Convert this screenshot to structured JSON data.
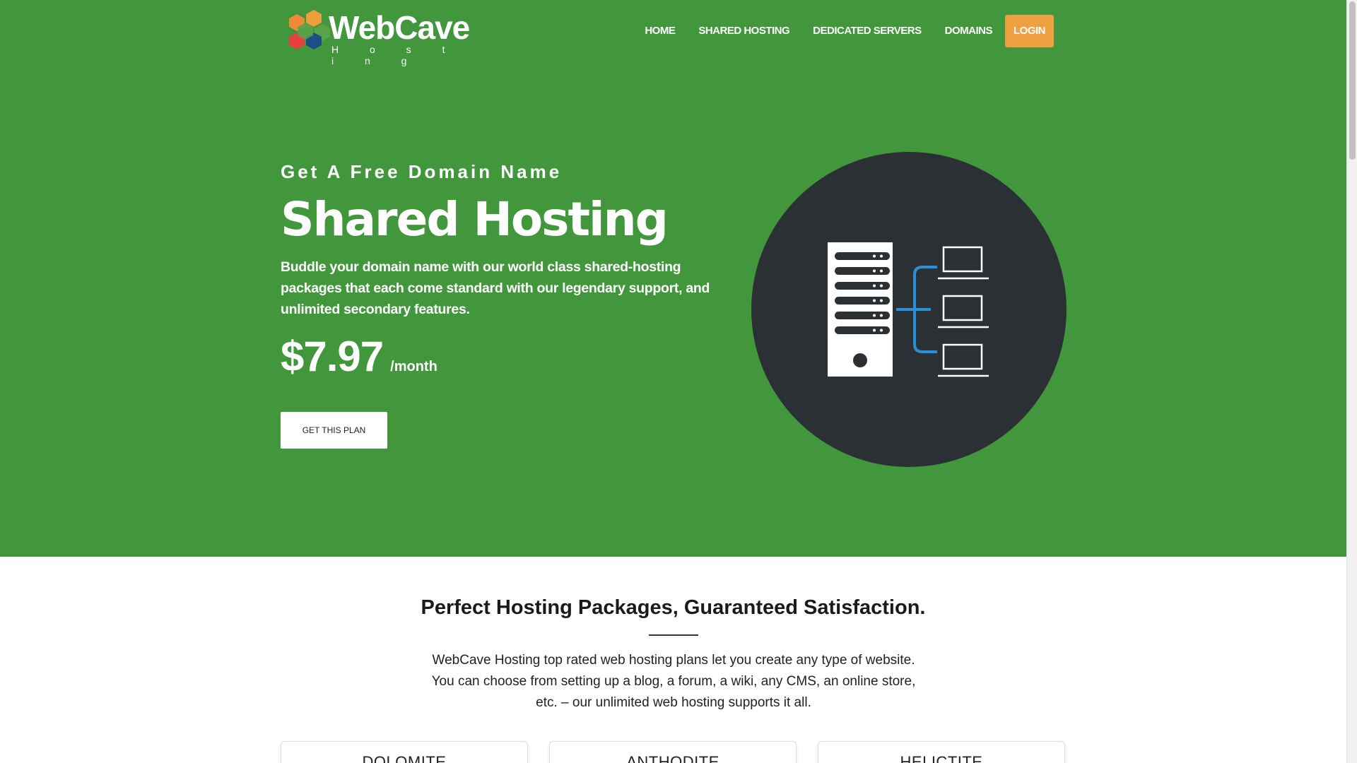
{
  "brand": {
    "name": "WebCave",
    "sub": "H o s t i n g",
    "hex_colors": [
      "#f08a3a",
      "#ef9e3b",
      "#e54141",
      "#1f4d8a",
      "#5aa348"
    ]
  },
  "nav": {
    "items": [
      {
        "label": "HOME"
      },
      {
        "label": "SHARED HOSTING"
      },
      {
        "label": "DEDICATED SERVERS"
      },
      {
        "label": "DOMAINS"
      },
      {
        "label": "LOGIN"
      }
    ]
  },
  "hero": {
    "eyebrow": "Get A Free Domain Name",
    "title": "Shared Hosting",
    "description": "Buddle your domain name with our world class shared-hosting packages that each come standard with our legendary support, and unlimited secondary features.",
    "price": "$7.97",
    "price_period": "/month",
    "cta_label": "GET THIS PLAN",
    "illustration": "server-network-icon"
  },
  "packages": {
    "title": "Perfect Hosting Packages, Guaranteed Satisfaction.",
    "description": "WebCave Hosting top rated web hosting plans let you create any type of website. You can choose from setting up a blog, a forum, a wiki, any CMS, an online store, etc. – our unlimited web hosting supports it all.",
    "cards": [
      {
        "name": "DOLOMITE"
      },
      {
        "name": "ANTHODITE"
      },
      {
        "name": "HELICTITE"
      }
    ]
  },
  "colors": {
    "hero_bg": "#42973d",
    "accent": "#ee9f3f",
    "dark_circle": "#2b3035",
    "link_blue": "#2b8fd6"
  }
}
